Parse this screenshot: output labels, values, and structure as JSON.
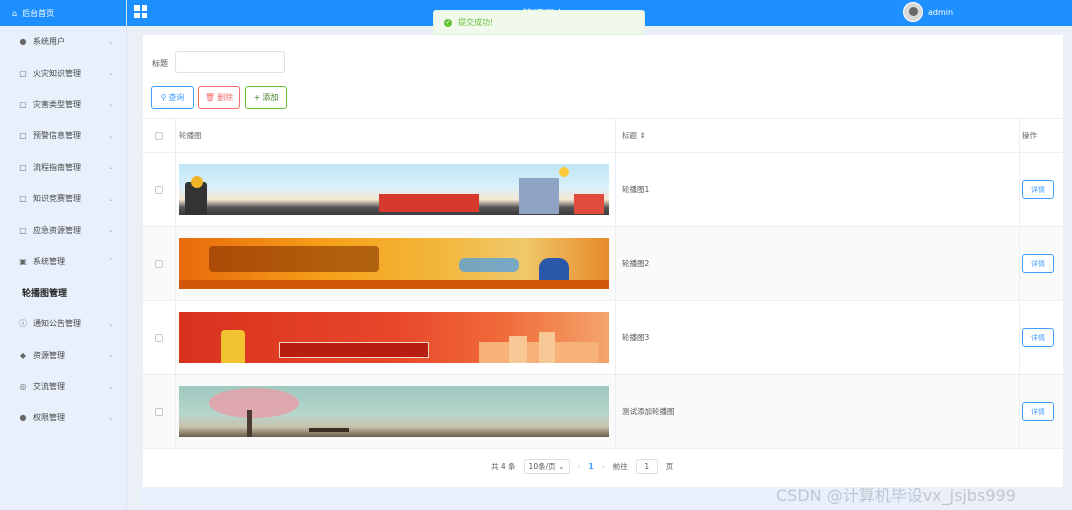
{
  "sidebar": {
    "home_label": "后台首页",
    "items": [
      {
        "label": "系统用户",
        "icon": "user-icon"
      },
      {
        "label": "火灾知识管理",
        "icon": "doc-icon"
      },
      {
        "label": "灾害类型管理",
        "icon": "doc-icon"
      },
      {
        "label": "预警信息管理",
        "icon": "doc-icon"
      },
      {
        "label": "流程指南管理",
        "icon": "doc-icon"
      },
      {
        "label": "知识竞赛管理",
        "icon": "doc-icon"
      },
      {
        "label": "应急资源管理",
        "icon": "doc-icon"
      },
      {
        "label": "系统管理",
        "icon": "picture-icon"
      },
      {
        "label": "通知公告管理",
        "icon": "info-icon"
      },
      {
        "label": "资源管理",
        "icon": "shield-icon"
      },
      {
        "label": "交流管理",
        "icon": "chat-icon"
      },
      {
        "label": "权限管理",
        "icon": "user-icon"
      }
    ],
    "sub_item": "轮播图管理"
  },
  "topbar": {
    "title": "管理平台",
    "user": "admin"
  },
  "toast": {
    "message": "提交成功!"
  },
  "search": {
    "label": "标题",
    "value": ""
  },
  "buttons": {
    "query": "查询",
    "delete": "删除",
    "add": "添加"
  },
  "table": {
    "headers": {
      "image": "轮播图",
      "title": "标题 ⇕",
      "operation": "操作"
    },
    "rows": [
      {
        "title": "轮播图1",
        "action": "详情"
      },
      {
        "title": "轮播图2",
        "action": "详情"
      },
      {
        "title": "轮播图3",
        "action": "详情"
      },
      {
        "title": "测试添加轮播图",
        "action": "详情"
      }
    ]
  },
  "pagination": {
    "total": "共 4 条",
    "page_size": "10条/页",
    "current": "1",
    "goto_label": "前往",
    "goto_value": "1",
    "page_suffix": "页"
  },
  "watermark": "CSDN @计算机毕设vx_jsjbs999"
}
